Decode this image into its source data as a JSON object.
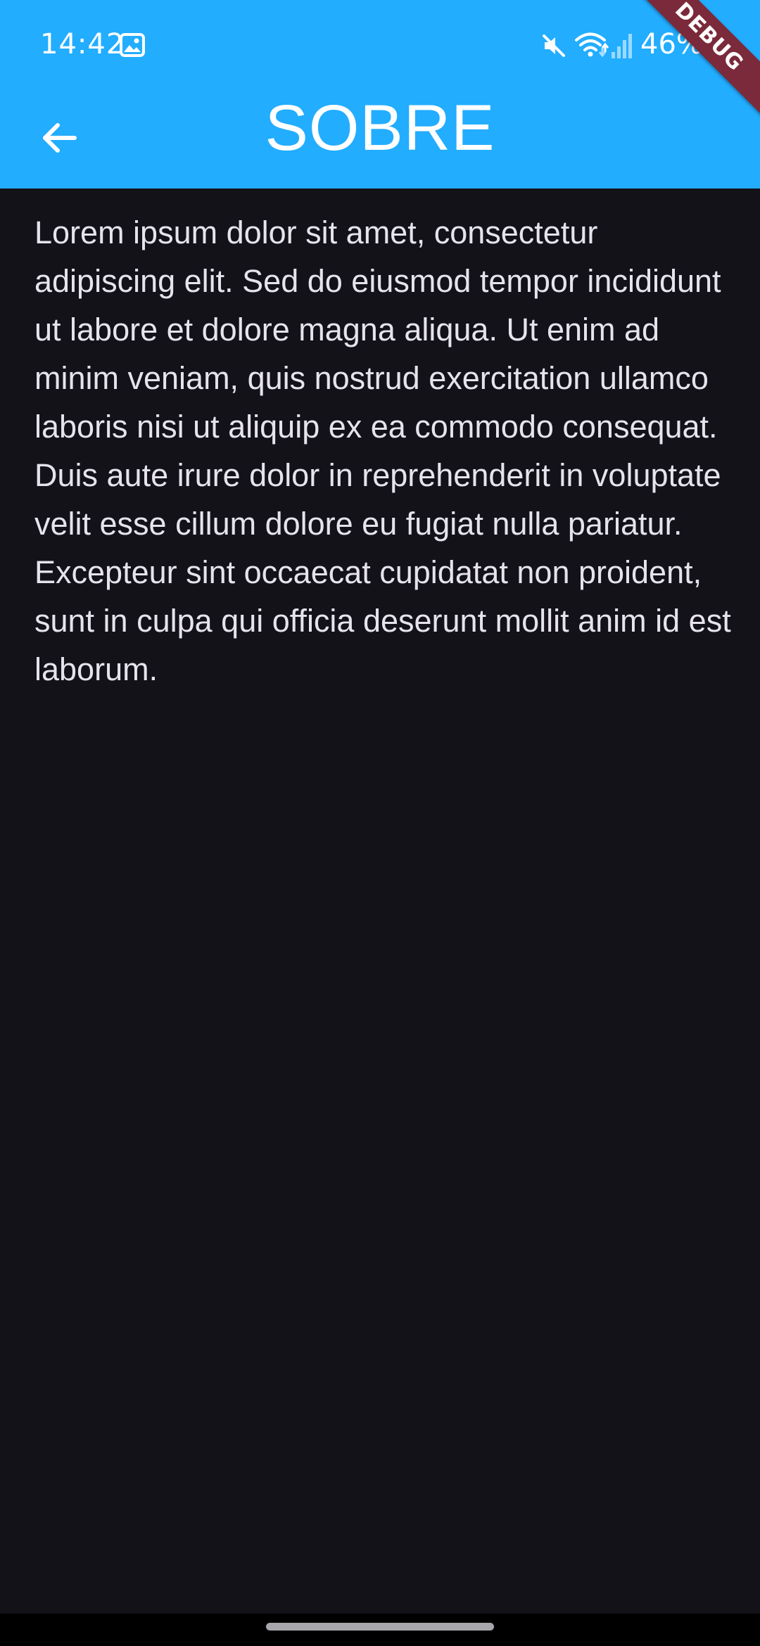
{
  "status_bar": {
    "time": "14:42",
    "battery": "46%",
    "icons": [
      "gallery-icon",
      "mute-icon",
      "wifi-icon",
      "signal-icon",
      "battery-icon"
    ]
  },
  "debug_banner": "DEBUG",
  "app_bar": {
    "title": "SOBRE",
    "back_icon": "arrow-back-icon"
  },
  "content": {
    "body": "Lorem ipsum dolor sit amet, consectetur adipiscing elit. Sed do eiusmod tempor incididunt ut labore et dolore magna aliqua. Ut enim ad minim veniam, quis nostrud exercitation ullamco laboris nisi ut aliquip ex ea commodo consequat. Duis aute irure dolor in reprehenderit in voluptate velit esse cillum dolore eu fugiat nulla pariatur. Excepteur sint occaecat cupidatat non proident, sunt in culpa qui officia deserunt mollit anim id est laborum."
  },
  "colors": {
    "app_bar": "#22adff",
    "background": "#131218",
    "text": "#e6e3ec",
    "debug_ribbon": "#7a2a3a"
  }
}
